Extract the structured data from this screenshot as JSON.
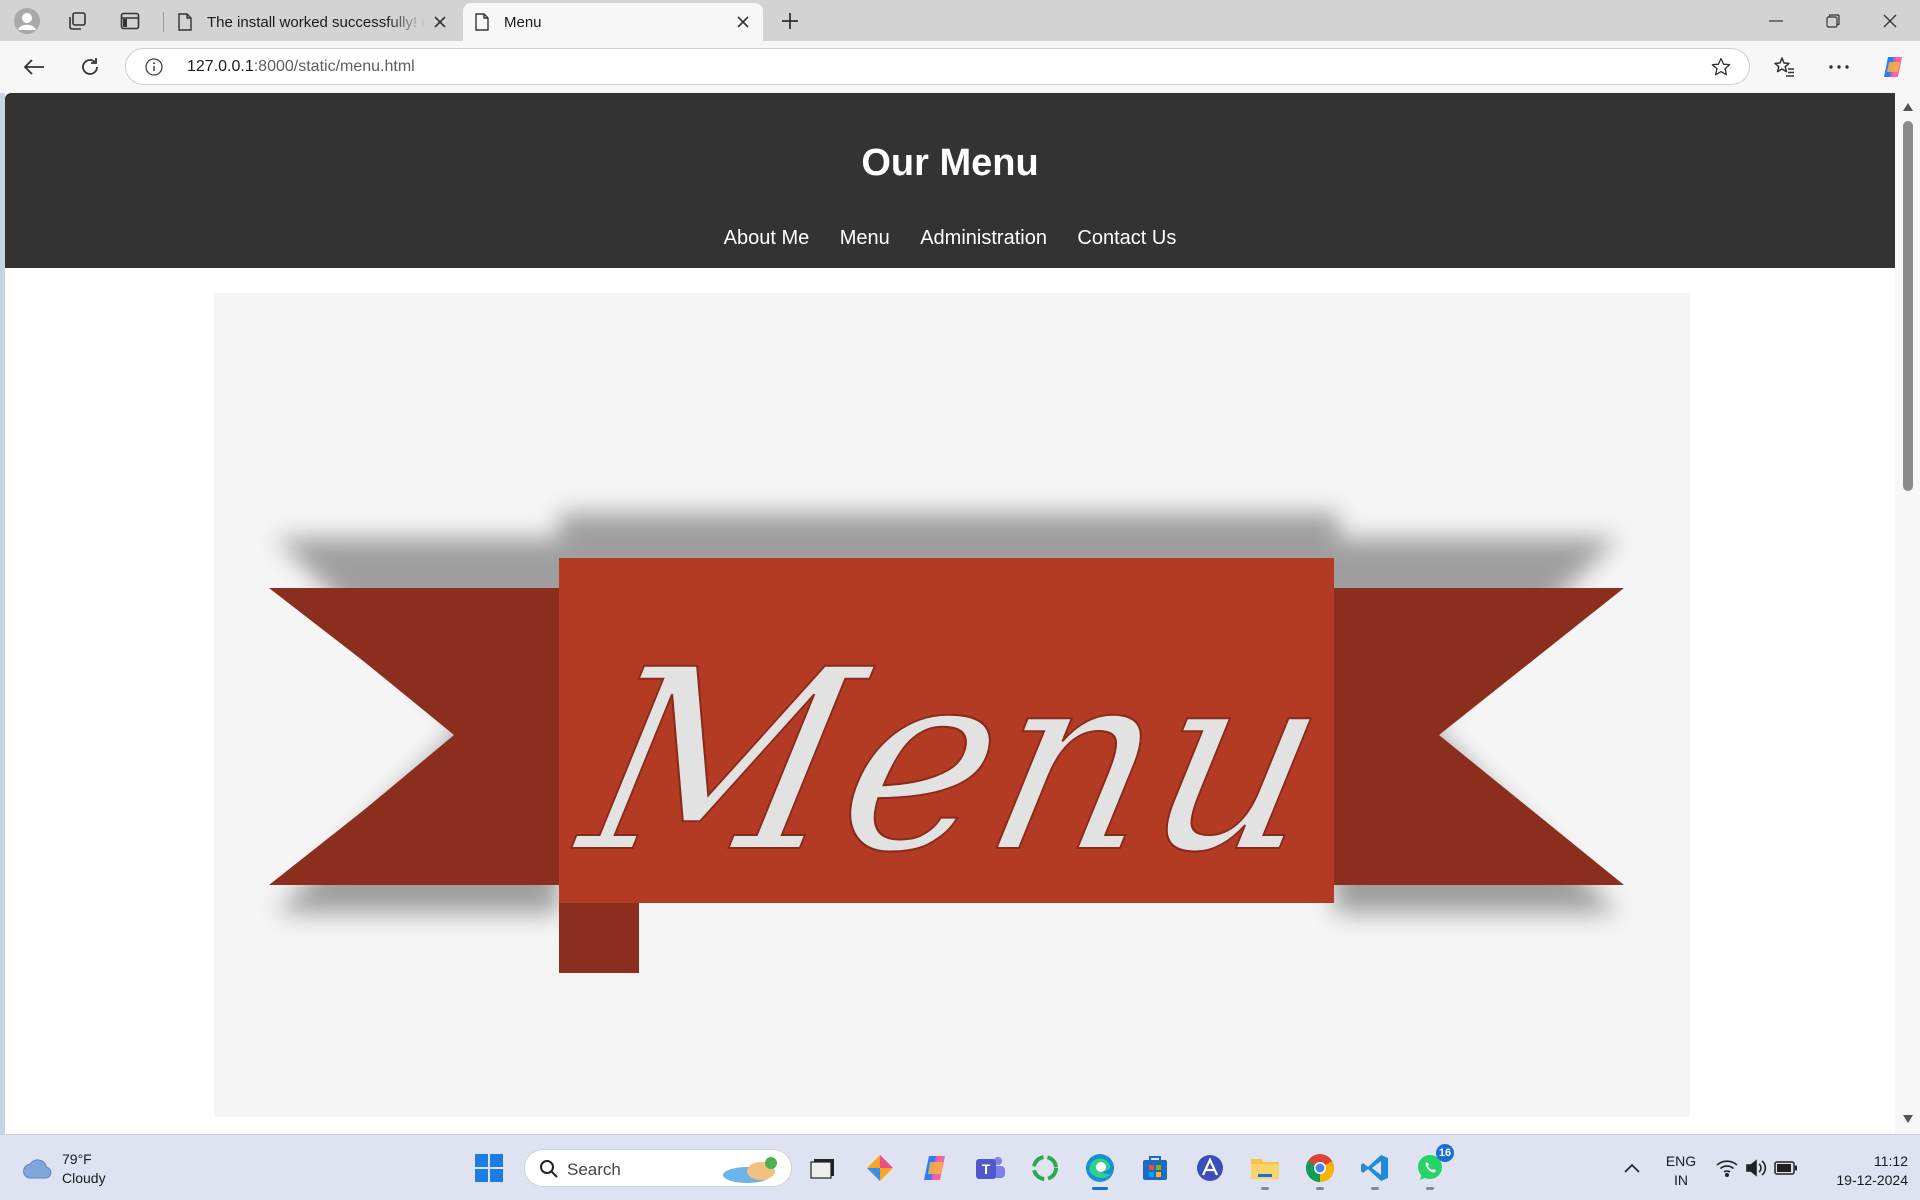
{
  "browser": {
    "tabs": [
      {
        "title": "The install worked successfully! Congratulations!",
        "active": false
      },
      {
        "title": "Menu",
        "active": true
      }
    ],
    "address": {
      "host": "127.0.0.1",
      "path": ":8000/static/menu.html"
    }
  },
  "page": {
    "title": "Our Menu",
    "nav": [
      "About Me",
      "Menu",
      "Administration",
      "Contact Us"
    ],
    "banner": {
      "text": "Menu",
      "colors": {
        "ribbon_front": "#b33b24",
        "ribbon_back": "#8c2e1e",
        "lettering": "#e2e2e2"
      }
    }
  },
  "taskbar": {
    "weather": {
      "temp": "79°F",
      "condition": "Cloudy"
    },
    "search_placeholder": "Search",
    "whatsapp_badge": "16",
    "language": {
      "line1": "ENG",
      "line2": "IN"
    },
    "clock": {
      "time": "11:12",
      "date": "19-12-2024"
    }
  }
}
